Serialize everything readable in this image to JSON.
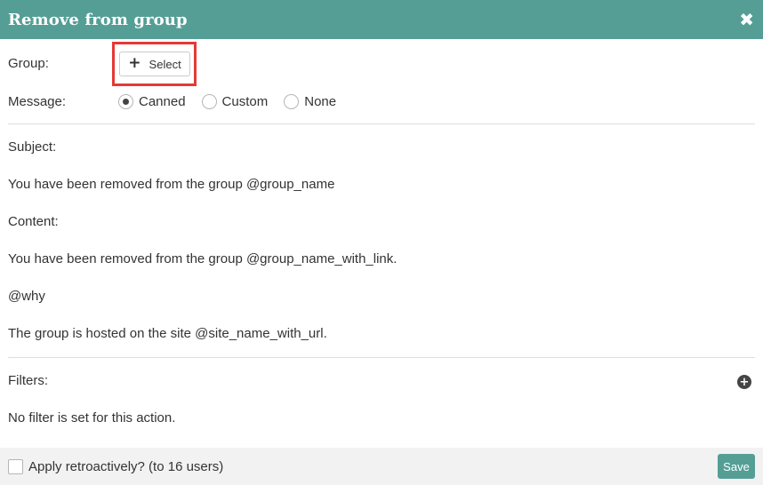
{
  "dialog": {
    "title": "Remove from group",
    "close_icon": "close-icon"
  },
  "group": {
    "label": "Group:",
    "select_label": "Select",
    "select_icon": "plus-icon"
  },
  "message": {
    "label": "Message:",
    "options": [
      {
        "label": "Canned",
        "checked": true
      },
      {
        "label": "Custom",
        "checked": false
      },
      {
        "label": "None",
        "checked": false
      }
    ]
  },
  "subject": {
    "label": "Subject:",
    "value": "You have been removed from the group @group_name"
  },
  "content": {
    "label": "Content:",
    "lines": [
      "You have been removed from the group @group_name_with_link.",
      "@why",
      "The group is hosted on the site @site_name_with_url."
    ]
  },
  "filters": {
    "label": "Filters:",
    "empty_text": "No filter is set for this action.",
    "add_icon": "add-circle-icon"
  },
  "footer": {
    "retro_label": "Apply retroactively? (to 16 users)",
    "retro_checked": false,
    "save_label": "Save"
  },
  "colors": {
    "header_bg": "#559e96",
    "highlight_border": "#e53935",
    "save_bg": "#559e96"
  }
}
